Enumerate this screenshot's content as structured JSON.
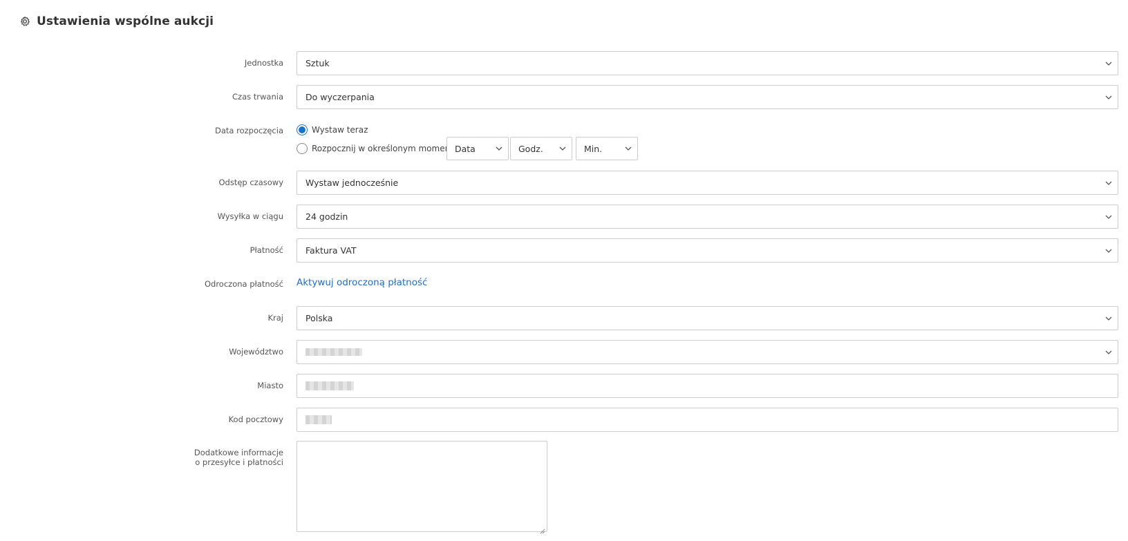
{
  "header": {
    "title": "Ustawienia wspólne aukcji",
    "icon": "gear-icon"
  },
  "fields": {
    "unit": {
      "label": "Jednostka",
      "value": "Sztuk"
    },
    "duration": {
      "label": "Czas trwania",
      "value": "Do wyczerpania"
    },
    "start": {
      "label": "Data rozpoczęcia",
      "option_now": "Wystaw teraz",
      "option_scheduled": "Rozpocznij w określonym momencie",
      "selected": "now",
      "date": "Data",
      "hour": "Godz.",
      "minute": "Min."
    },
    "interval": {
      "label": "Odstęp czasowy",
      "value": "Wystaw jednocześnie"
    },
    "shipping": {
      "label": "Wysyłka w ciągu",
      "value": "24 godzin"
    },
    "payment": {
      "label": "Płatność",
      "value": "Faktura VAT"
    },
    "deferred": {
      "label": "Odroczona płatność",
      "link": "Aktywuj odroczoną płatność"
    },
    "country": {
      "label": "Kraj",
      "value": "Polska"
    },
    "province": {
      "label": "Województwo"
    },
    "city": {
      "label": "Miasto"
    },
    "postal": {
      "label": "Kod pocztowy"
    },
    "additional": {
      "label_line1": "Dodatkowe informacje",
      "label_line2": "o przesyłce i płatności"
    }
  },
  "colors": {
    "accent": "#1f6fc1",
    "border": "#cccccc"
  }
}
